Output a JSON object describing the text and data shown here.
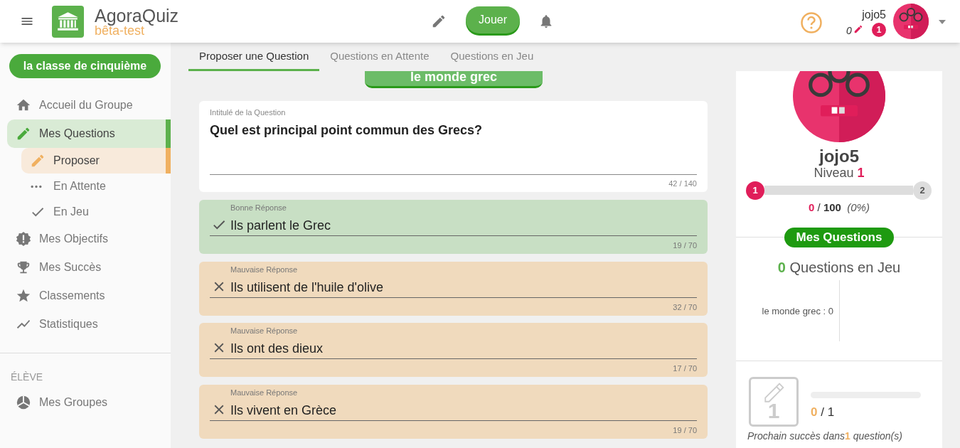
{
  "header": {
    "app_name": "AgoraQuiz",
    "subtitle": "bêta-test",
    "play_button": "Jouer",
    "user_name": "jojo5",
    "proposed_count": "0",
    "notification_badge": "1"
  },
  "sidebar": {
    "group_button": "la classe de cinquième",
    "items": [
      {
        "label": "Accueil du Groupe",
        "selected": false
      },
      {
        "label": "Mes Questions",
        "selected": true,
        "children": [
          {
            "label": "Proposer",
            "selected": true
          },
          {
            "label": "En Attente",
            "selected": false
          },
          {
            "label": "En Jeu",
            "selected": false
          }
        ]
      },
      {
        "label": "Mes Objectifs",
        "selected": false
      },
      {
        "label": "Mes Succès",
        "selected": false
      },
      {
        "label": "Classements",
        "selected": false
      },
      {
        "label": "Statistiques",
        "selected": false
      }
    ],
    "section_label": "ÉLÈVE",
    "section_items": [
      {
        "label": "Mes Groupes",
        "selected": false
      }
    ]
  },
  "tabs": [
    {
      "label": "Proposer une Question",
      "selected": true
    },
    {
      "label": "Questions en Attente",
      "selected": false
    },
    {
      "label": "Questions en Jeu",
      "selected": false
    }
  ],
  "theme_button": "le monde grec",
  "question": {
    "label": "Intitulé de la Question",
    "value": "Quel est principal point commun des Grecs?",
    "counter": "42 / 140"
  },
  "answers": [
    {
      "kind": "correct",
      "label": "Bonne Réponse",
      "value": "Ils parlent le Grec",
      "counter": "19 / 70"
    },
    {
      "kind": "wrong",
      "label": "Mauvaise Réponse",
      "value": "Ils utilisent de l'huile d'olive",
      "counter": "32 / 70"
    },
    {
      "kind": "wrong",
      "label": "Mauvaise Réponse",
      "value": "Ils ont des dieux",
      "counter": "17 / 70"
    },
    {
      "kind": "wrong",
      "label": "Mauvaise Réponse",
      "value": "Ils vivent en Grèce",
      "counter": "19 / 70"
    }
  ],
  "profile": {
    "name": "jojo5",
    "level_label": "Niveau",
    "level": "1",
    "progress": {
      "level": 0,
      "start": "1",
      "end": "2"
    },
    "points": "0",
    "points_total": "/ 100",
    "percent": "(0%)"
  },
  "stats": {
    "badge": "Mes Questions",
    "count": "0",
    "count_label": "Questions en Jeu",
    "rows": [
      "le monde grec : 0"
    ]
  },
  "achievement": {
    "number": "1",
    "progress": {
      "level": 0
    },
    "current": "0",
    "total": "/ 1",
    "text_before": "Prochain succès dans",
    "text_count": "1",
    "text_after": "question(s)"
  }
}
